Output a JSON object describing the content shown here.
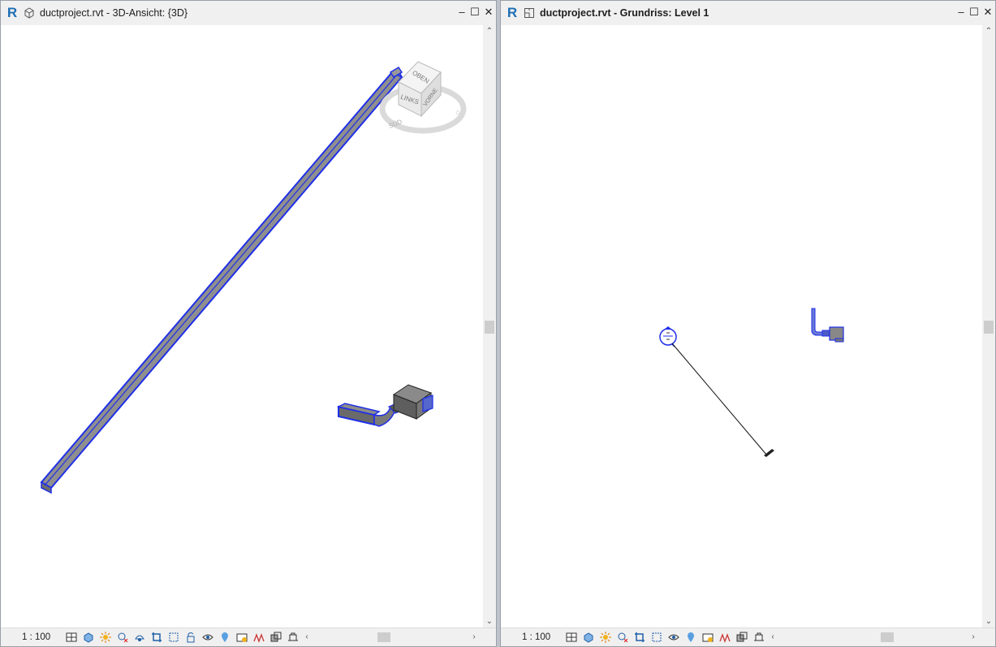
{
  "left_window": {
    "logo": "R",
    "title": "ductproject.rvt - 3D-Ansicht: {3D}",
    "scale": "1 : 100",
    "viewcube": {
      "top": "OBEN",
      "front": "LINKS",
      "side": "VORNE",
      "compass": "SÜD"
    },
    "view_type": "3d-view-icon"
  },
  "right_window": {
    "logo": "R",
    "title": "ductproject.rvt - Grundriss: Level 1",
    "scale": "1 : 100",
    "view_type": "floor-plan-icon"
  },
  "window_controls": {
    "minimize": "–",
    "maximize": "☐",
    "close": "✕"
  },
  "scroll": {
    "up": "⌃",
    "down": "⌄",
    "left": "‹",
    "right": "›"
  },
  "view_control_icons_left": [
    "detail-level-icon",
    "visual-style-icon",
    "sun-path-icon",
    "shadows-icon",
    "show-rendering-icon",
    "crop-view-icon",
    "show-crop-region-icon",
    "unlock-3d-view-icon",
    "temporary-hide-icon",
    "reveal-hidden-icon",
    "temporary-view-properties-icon",
    "analytical-model-icon",
    "highlight-displacement-icon",
    "worksharing-display-icon"
  ],
  "view_control_icons_right": [
    "detail-level-icon",
    "visual-style-icon",
    "sun-path-icon",
    "shadows-icon",
    "crop-view-icon",
    "show-crop-region-icon",
    "temporary-hide-icon",
    "reveal-hidden-icon",
    "temporary-view-properties-icon",
    "analytical-model-icon",
    "highlight-displacement-icon",
    "worksharing-display-icon"
  ],
  "colors": {
    "selection_blue": "#1f2fe8",
    "duct_gray": "#8a8a8a",
    "revit_blue": "#1f6fb5"
  }
}
